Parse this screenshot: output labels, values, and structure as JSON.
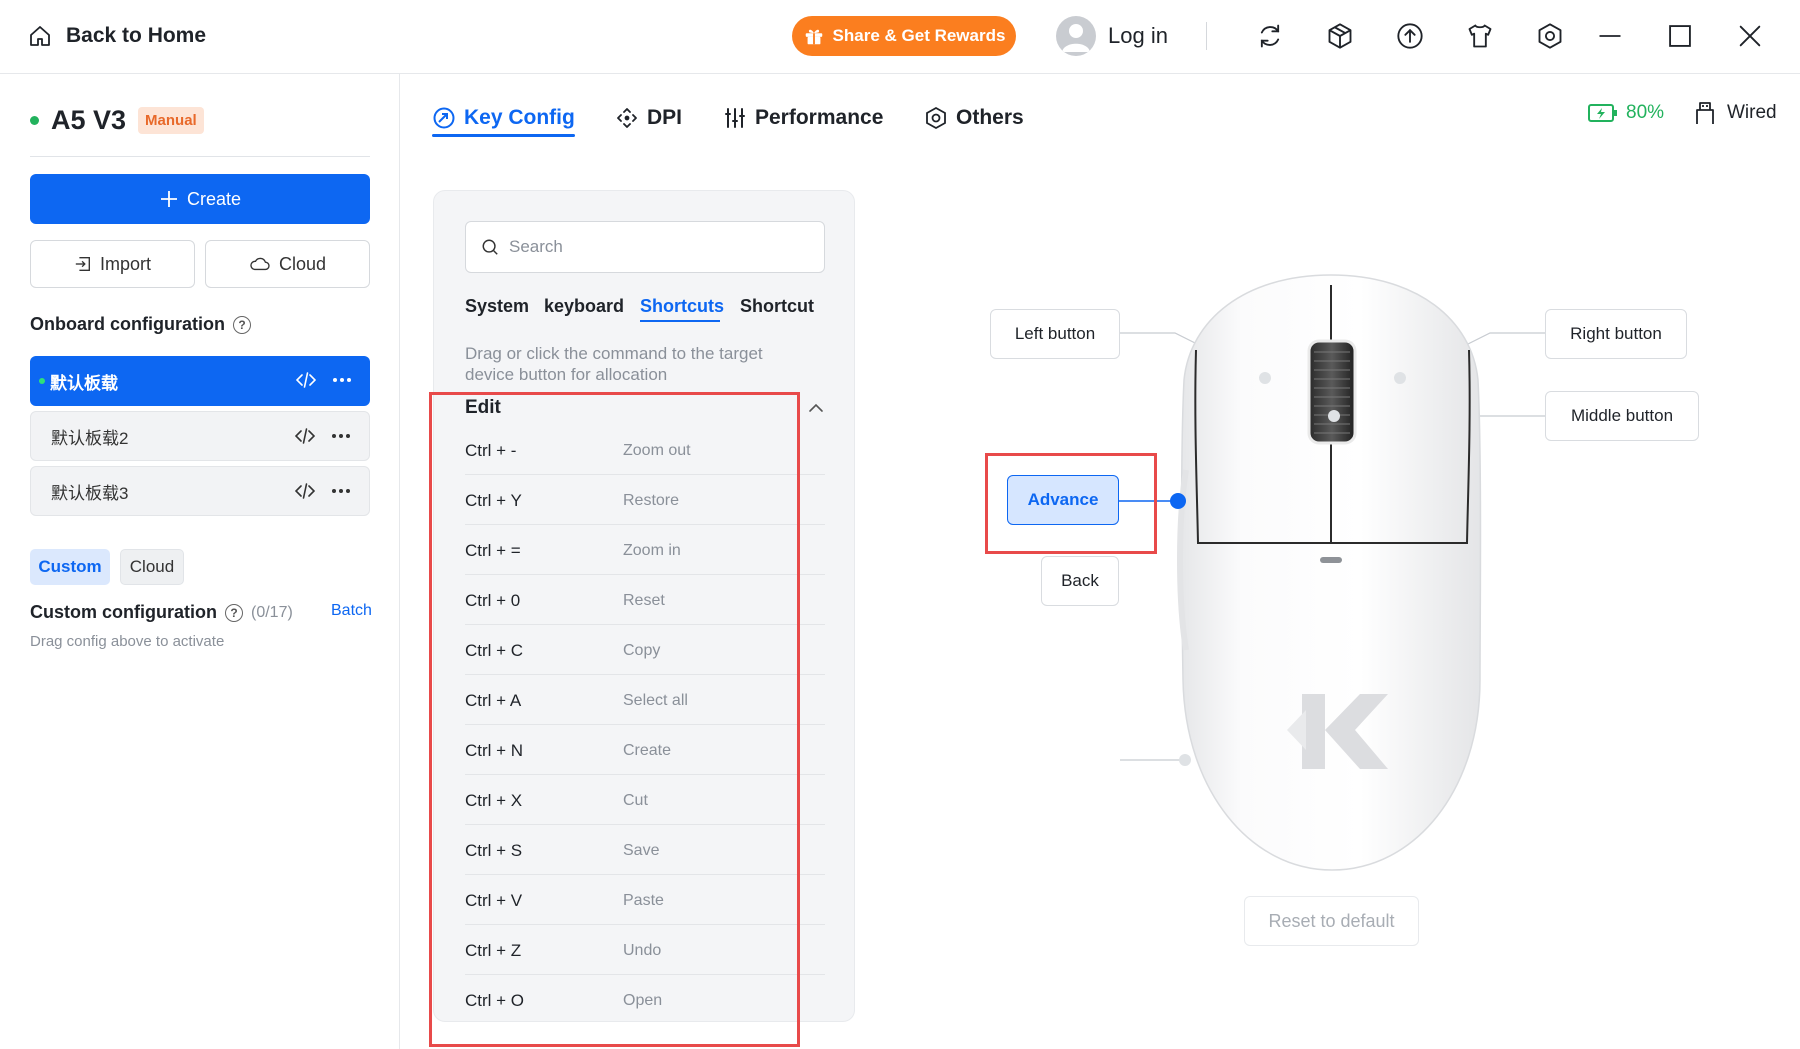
{
  "titlebar": {
    "back_label": "Back to Home",
    "share_label": "Share & Get Rewards",
    "login_label": "Log in",
    "icons": [
      "sync-icon",
      "cube-icon",
      "upload-icon",
      "tshirt-icon",
      "settings-hex-icon",
      "minimize-icon",
      "maximize-icon",
      "close-icon"
    ]
  },
  "device": {
    "name": "A5 V3",
    "mode_badge": "Manual",
    "status_color": "#22b25d"
  },
  "sidebar": {
    "create_label": "Create",
    "import_label": "Import",
    "cloud_label": "Cloud",
    "onboard_title": "Onboard configuration",
    "configs": [
      {
        "label": "默认板载"
      },
      {
        "label": "默认板载2"
      },
      {
        "label": "默认板载3"
      }
    ],
    "chip_custom": "Custom",
    "chip_cloud": "Cloud",
    "custom_title": "Custom configuration",
    "custom_count": "(0/17)",
    "batch_label": "Batch",
    "custom_hint": "Drag config above to activate"
  },
  "tabs": [
    {
      "label": "Key Config"
    },
    {
      "label": "DPI"
    },
    {
      "label": "Performance"
    },
    {
      "label": "Others"
    }
  ],
  "status": {
    "battery": "80%",
    "connection": "Wired"
  },
  "commands": {
    "search_placeholder": "Search",
    "categories": [
      "System",
      "keyboard",
      "Shortcuts",
      "Shortcut"
    ],
    "active_category": "Shortcuts",
    "hint": "Drag or click the command to the target device button for allocation",
    "group_title": "Edit",
    "items": [
      {
        "key": "Ctrl + -",
        "desc": "Zoom out"
      },
      {
        "key": "Ctrl + Y",
        "desc": "Restore"
      },
      {
        "key": "Ctrl + =",
        "desc": "Zoom in"
      },
      {
        "key": "Ctrl + 0",
        "desc": "Reset"
      },
      {
        "key": "Ctrl + C",
        "desc": "Copy"
      },
      {
        "key": "Ctrl + A",
        "desc": "Select all"
      },
      {
        "key": "Ctrl + N",
        "desc": "Create"
      },
      {
        "key": "Ctrl + X",
        "desc": "Cut"
      },
      {
        "key": "Ctrl + S",
        "desc": "Save"
      },
      {
        "key": "Ctrl + V",
        "desc": "Paste"
      },
      {
        "key": "Ctrl + Z",
        "desc": "Undo"
      },
      {
        "key": "Ctrl + O",
        "desc": "Open"
      }
    ]
  },
  "mouse": {
    "left_button": "Left button",
    "right_button": "Right button",
    "middle_button": "Middle button",
    "advance_button": "Advance",
    "back_button": "Back",
    "reset_label": "Reset to default"
  },
  "colors": {
    "accent": "#0d67f2",
    "share": "#fb7e1f",
    "annotation": "#e84a4a"
  }
}
